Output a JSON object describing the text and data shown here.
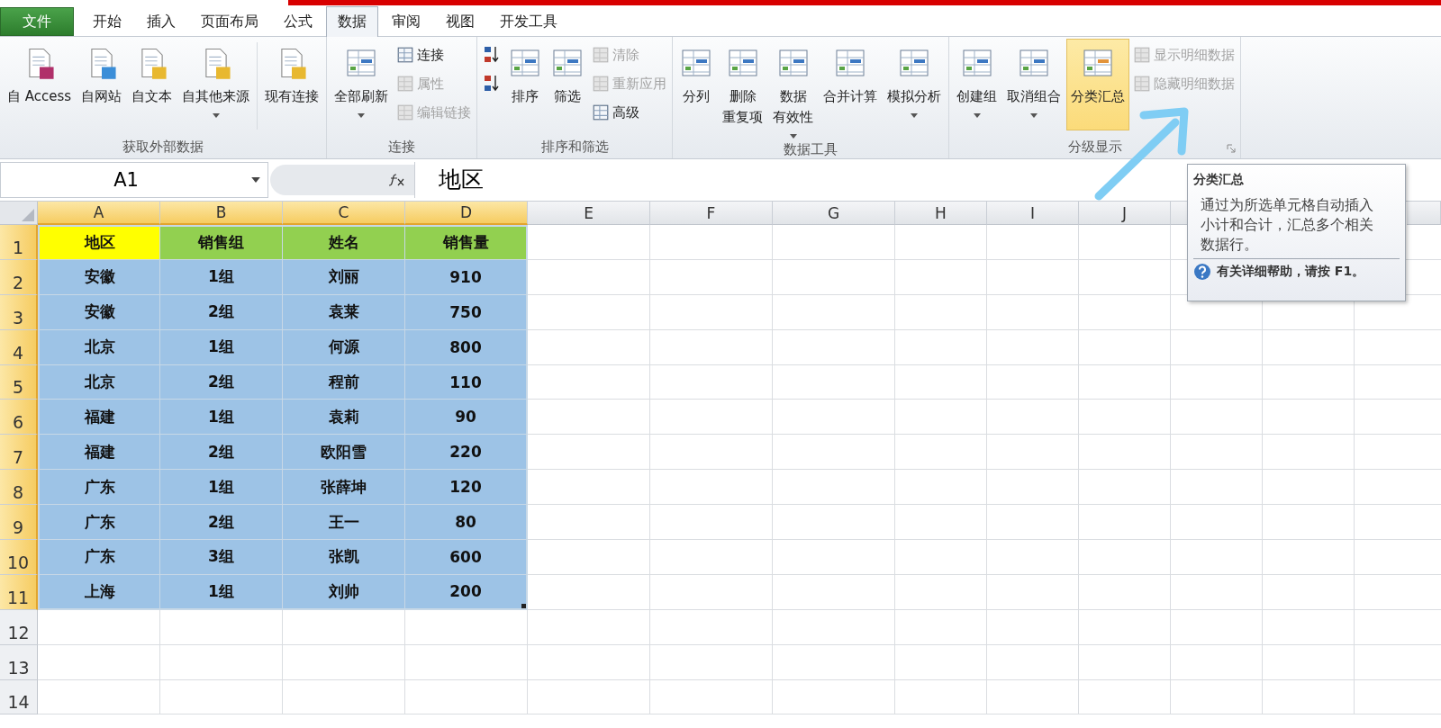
{
  "tabs": [
    {
      "label": "文件",
      "kind": "file",
      "selected": false
    },
    {
      "label": "开始",
      "kind": "tab",
      "selected": false
    },
    {
      "label": "插入",
      "kind": "tab",
      "selected": false
    },
    {
      "label": "页面布局",
      "kind": "tab",
      "selected": false
    },
    {
      "label": "公式",
      "kind": "tab",
      "selected": false
    },
    {
      "label": "数据",
      "kind": "tab",
      "selected": true
    },
    {
      "label": "审阅",
      "kind": "tab",
      "selected": false
    },
    {
      "label": "视图",
      "kind": "tab",
      "selected": false
    },
    {
      "label": "开发工具",
      "kind": "tab",
      "selected": false
    }
  ],
  "ribbon": [
    {
      "label": "获取外部数据",
      "launcher": false,
      "items": [
        {
          "kind": "large",
          "label": "自 Access",
          "dropdown": false,
          "highlighted": false
        },
        {
          "kind": "large",
          "label": "自网站",
          "dropdown": false,
          "highlighted": false
        },
        {
          "kind": "large",
          "label": "自文本",
          "dropdown": false,
          "highlighted": false
        },
        {
          "kind": "large",
          "label": "自其他来源",
          "dropdown": true,
          "highlighted": false
        },
        {
          "kind": "separator"
        },
        {
          "kind": "large",
          "label": "现有连接",
          "dropdown": false,
          "highlighted": false
        }
      ]
    },
    {
      "label": "连接",
      "launcher": false,
      "items": [
        {
          "kind": "large",
          "label": "全部刷新",
          "dropdown": true,
          "highlighted": false
        },
        {
          "kind": "stack",
          "items": [
            {
              "label": "连接",
              "disabled": false
            },
            {
              "label": "属性",
              "disabled": true
            },
            {
              "label": "编辑链接",
              "disabled": true
            }
          ]
        }
      ]
    },
    {
      "label": "排序和筛选",
      "launcher": false,
      "items": [
        {
          "kind": "stack",
          "items": [
            {
              "disabled": false
            },
            {
              "disabled": false
            }
          ]
        },
        {
          "kind": "large",
          "label": "排序",
          "dropdown": false,
          "highlighted": false
        },
        {
          "kind": "large",
          "label": "筛选",
          "dropdown": false,
          "highlighted": false
        },
        {
          "kind": "stack",
          "items": [
            {
              "label": "清除",
              "disabled": true
            },
            {
              "label": "重新应用",
              "disabled": true
            },
            {
              "label": "高级",
              "disabled": false
            }
          ]
        }
      ]
    },
    {
      "label": "数据工具",
      "launcher": false,
      "items": [
        {
          "kind": "large",
          "label": "分列",
          "dropdown": false,
          "highlighted": false
        },
        {
          "kind": "large",
          "lines": [
            "删除",
            "重复项"
          ],
          "dropdown": false,
          "highlighted": false
        },
        {
          "kind": "large",
          "lines": [
            "数据",
            "有效性"
          ],
          "dropdown": true,
          "highlighted": false
        },
        {
          "kind": "large",
          "label": "合并计算",
          "dropdown": false,
          "highlighted": false
        },
        {
          "kind": "large",
          "label": "模拟分析",
          "dropdown": true,
          "highlighted": false
        }
      ]
    },
    {
      "label": "分级显示",
      "launcher": true,
      "items": [
        {
          "kind": "large",
          "label": "创建组",
          "dropdown": true,
          "highlighted": false
        },
        {
          "kind": "large",
          "label": "取消组合",
          "dropdown": true,
          "highlighted": false
        },
        {
          "kind": "large",
          "label": "分类汇总",
          "dropdown": false,
          "highlighted": true
        },
        {
          "kind": "stack",
          "items": [
            {
              "label": "显示明细数据",
              "disabled": true
            },
            {
              "label": "隐藏明细数据",
              "disabled": true
            }
          ]
        }
      ]
    }
  ],
  "name_box": "A1",
  "formula": "地区",
  "columns": [
    {
      "label": "A",
      "selected": true
    },
    {
      "label": "B",
      "selected": true
    },
    {
      "label": "C",
      "selected": true
    },
    {
      "label": "D",
      "selected": true
    },
    {
      "label": "E",
      "selected": false
    },
    {
      "label": "F",
      "selected": false
    },
    {
      "label": "G",
      "selected": false
    },
    {
      "label": "H",
      "selected": false
    },
    {
      "label": "I",
      "selected": false
    },
    {
      "label": "J",
      "selected": false
    }
  ],
  "rows": [
    {
      "label": "1",
      "selected": true,
      "cells": [
        {
          "text": "地区",
          "color": "#ffff00"
        },
        {
          "text": "销售组",
          "color": "#92d050"
        },
        {
          "text": "姓名",
          "color": "#92d050"
        },
        {
          "text": "销售量",
          "color": "#92d050"
        }
      ]
    },
    {
      "label": "2",
      "selected": true,
      "cells": [
        {
          "text": "安徽",
          "color": "#9dc3e6"
        },
        {
          "text": "1组",
          "color": "#9dc3e6"
        },
        {
          "text": "刘丽",
          "color": "#9dc3e6"
        },
        {
          "text": "910",
          "color": "#9dc3e6"
        }
      ]
    },
    {
      "label": "3",
      "selected": true,
      "cells": [
        {
          "text": "安徽",
          "color": "#9dc3e6"
        },
        {
          "text": "2组",
          "color": "#9dc3e6"
        },
        {
          "text": "袁莱",
          "color": "#9dc3e6"
        },
        {
          "text": "750",
          "color": "#9dc3e6"
        }
      ]
    },
    {
      "label": "4",
      "selected": true,
      "cells": [
        {
          "text": "北京",
          "color": "#9dc3e6"
        },
        {
          "text": "1组",
          "color": "#9dc3e6"
        },
        {
          "text": "何源",
          "color": "#9dc3e6"
        },
        {
          "text": "800",
          "color": "#9dc3e6"
        }
      ]
    },
    {
      "label": "5",
      "selected": true,
      "cells": [
        {
          "text": "北京",
          "color": "#9dc3e6"
        },
        {
          "text": "2组",
          "color": "#9dc3e6"
        },
        {
          "text": "程前",
          "color": "#9dc3e6"
        },
        {
          "text": "110",
          "color": "#9dc3e6"
        }
      ]
    },
    {
      "label": "6",
      "selected": true,
      "cells": [
        {
          "text": "福建",
          "color": "#9dc3e6"
        },
        {
          "text": "1组",
          "color": "#9dc3e6"
        },
        {
          "text": "袁莉",
          "color": "#9dc3e6"
        },
        {
          "text": "90",
          "color": "#9dc3e6"
        }
      ]
    },
    {
      "label": "7",
      "selected": true,
      "cells": [
        {
          "text": "福建",
          "color": "#9dc3e6"
        },
        {
          "text": "2组",
          "color": "#9dc3e6"
        },
        {
          "text": "欧阳雪",
          "color": "#9dc3e6"
        },
        {
          "text": "220",
          "color": "#9dc3e6"
        }
      ]
    },
    {
      "label": "8",
      "selected": true,
      "cells": [
        {
          "text": "广东",
          "color": "#9dc3e6"
        },
        {
          "text": "1组",
          "color": "#9dc3e6"
        },
        {
          "text": "张薛坤",
          "color": "#9dc3e6"
        },
        {
          "text": "120",
          "color": "#9dc3e6"
        }
      ]
    },
    {
      "label": "9",
      "selected": true,
      "cells": [
        {
          "text": "广东",
          "color": "#9dc3e6"
        },
        {
          "text": "2组",
          "color": "#9dc3e6"
        },
        {
          "text": "王一",
          "color": "#9dc3e6"
        },
        {
          "text": "80",
          "color": "#9dc3e6"
        }
      ]
    },
    {
      "label": "10",
      "selected": true,
      "cells": [
        {
          "text": "广东",
          "color": "#9dc3e6"
        },
        {
          "text": "3组",
          "color": "#9dc3e6"
        },
        {
          "text": "张凯",
          "color": "#9dc3e6"
        },
        {
          "text": "600",
          "color": "#9dc3e6"
        }
      ]
    },
    {
      "label": "11",
      "selected": true,
      "cells": [
        {
          "text": "上海",
          "color": "#9dc3e6"
        },
        {
          "text": "1组",
          "color": "#9dc3e6"
        },
        {
          "text": "刘帅",
          "color": "#9dc3e6"
        },
        {
          "text": "200",
          "color": "#9dc3e6"
        }
      ]
    },
    {
      "label": "12",
      "selected": false
    },
    {
      "label": "13",
      "selected": false
    },
    {
      "label": "14",
      "selected": false
    }
  ],
  "tooltip": {
    "title": "分类汇总",
    "body": "通过为所选单元格自动插入小计和合计，汇总多个相关数据行。",
    "help": "有关详细帮助，请按 F1。"
  }
}
